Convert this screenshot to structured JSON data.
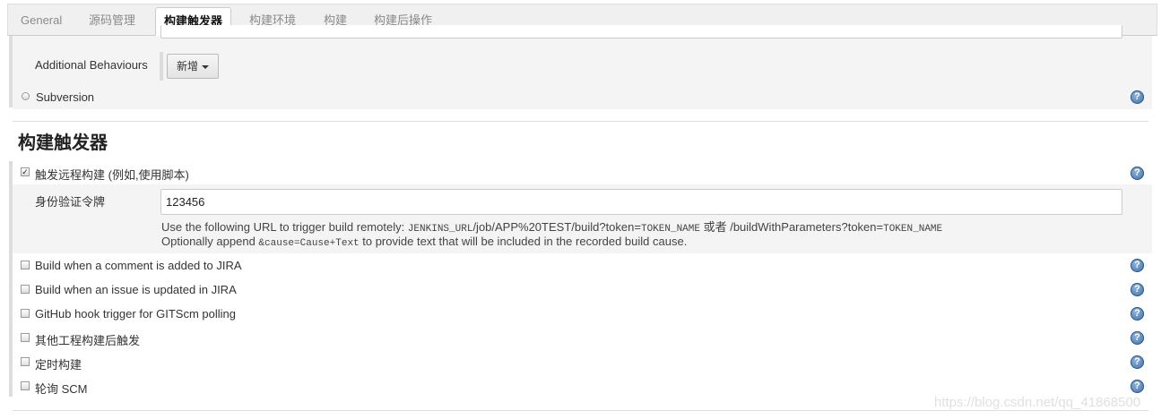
{
  "tabs": [
    "General",
    "源码管理",
    "构建触发器",
    "构建环境",
    "构建",
    "构建后操作"
  ],
  "active_tab": "构建触发器",
  "scm": {
    "additional_behaviours_label": "Additional Behaviours",
    "add_button_label": "新增",
    "subversion_label": "Subversion"
  },
  "triggers": {
    "section_title": "构建触发器",
    "remote_build": {
      "label": "触发远程构建 (例如,使用脚本)",
      "checked": true,
      "token_label": "身份验证令牌",
      "token_value": "123456",
      "help_line1_prefix": "Use the following URL to trigger build remotely: ",
      "help_line1_url1": "JENKINS_URL",
      "help_line1_mid": "/job/APP%20TEST/build?token=",
      "help_line1_token": "TOKEN_NAME",
      "help_line1_or": " 或者 /buildWithParameters?token=",
      "help_line1_token2": "TOKEN_NAME",
      "help_line2_prefix": "Optionally append ",
      "help_line2_code": "&cause=Cause+Text",
      "help_line2_suffix": " to provide text that will be included in the recorded build cause."
    },
    "options": [
      {
        "label": "Build when a comment is added to JIRA",
        "checked": false
      },
      {
        "label": "Build when an issue is updated in JIRA",
        "checked": false
      },
      {
        "label": "GitHub hook trigger for GITScm polling",
        "checked": false
      },
      {
        "label": "其他工程构建后触发",
        "checked": false
      },
      {
        "label": "定时构建",
        "checked": false
      },
      {
        "label": "轮询 SCM",
        "checked": false
      }
    ]
  },
  "watermark": "https://blog.csdn.net/qq_41868500"
}
